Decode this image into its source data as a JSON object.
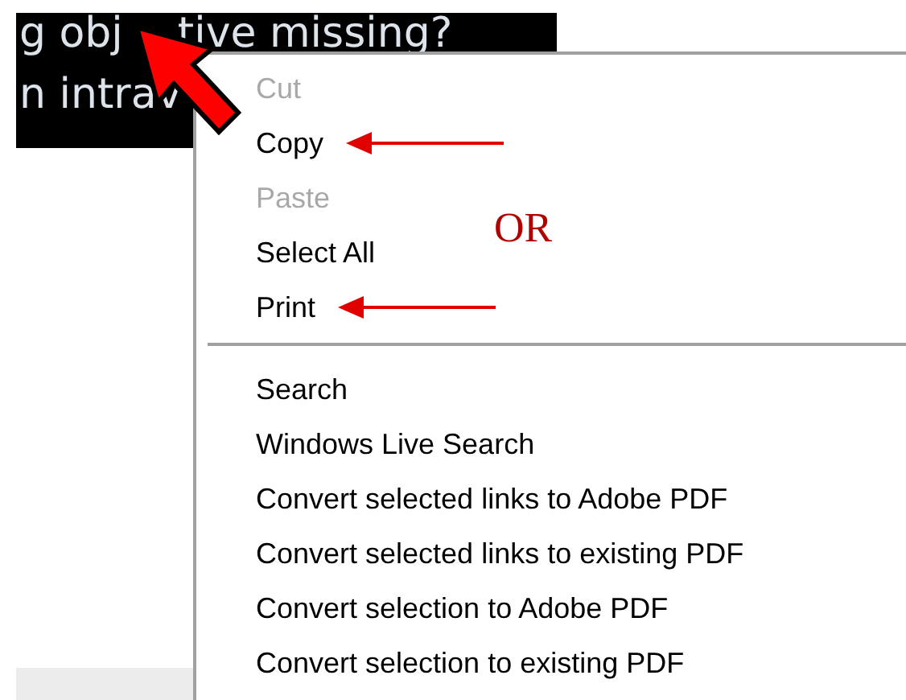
{
  "selected_text": {
    "lines": [
      {
        "segments": [
          "g obj",
          "tive missing?"
        ]
      },
      {
        "segments": [
          "n intrav"
        ]
      }
    ]
  },
  "context_menu": {
    "groups": [
      {
        "items": [
          {
            "label": "Cut",
            "disabled": true,
            "marked": false
          },
          {
            "label": "Copy",
            "disabled": false,
            "marked": true
          },
          {
            "label": "Paste",
            "disabled": true,
            "marked": false
          },
          {
            "label": "Select All",
            "disabled": false,
            "marked": false
          },
          {
            "label": "Print",
            "disabled": false,
            "marked": true
          }
        ]
      },
      {
        "items": [
          {
            "label": "Search",
            "disabled": false,
            "marked": false
          },
          {
            "label": "Windows Live Search",
            "disabled": false,
            "marked": false
          },
          {
            "label": "Convert selected links to Adobe PDF",
            "disabled": false,
            "marked": false
          },
          {
            "label": "Convert selected links to existing PDF",
            "disabled": false,
            "marked": false
          },
          {
            "label": "Convert selection to Adobe PDF",
            "disabled": false,
            "marked": false
          },
          {
            "label": "Convert selection to existing PDF",
            "disabled": false,
            "marked": false
          }
        ]
      }
    ]
  },
  "annotation": {
    "label": "OR"
  }
}
